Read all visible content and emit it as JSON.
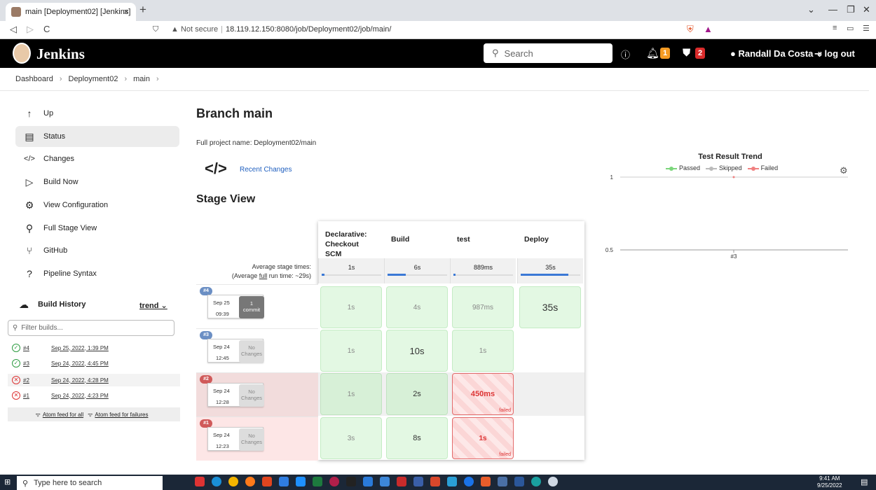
{
  "browser": {
    "tab_title": "main [Deployment02] [Jenkins]",
    "tab_close": "×",
    "new_tab": "+",
    "url_security": "Not secure",
    "url": "18.119.12.150:8080/job/Deployment02/job/main/"
  },
  "header": {
    "logo": "Jenkins",
    "search_placeholder": "Search",
    "notifications_count": "1",
    "security_count": "2",
    "user_name": "Randall Da Costa",
    "logout_label": "log out"
  },
  "breadcrumbs": [
    "Dashboard",
    "Deployment02",
    "main"
  ],
  "sidebar": {
    "items": [
      {
        "label": "Up",
        "icon": "arrow-up-icon"
      },
      {
        "label": "Status",
        "icon": "document-icon"
      },
      {
        "label": "Changes",
        "icon": "code-icon"
      },
      {
        "label": "Build Now",
        "icon": "play-icon"
      },
      {
        "label": "View Configuration",
        "icon": "gear-icon"
      },
      {
        "label": "Full Stage View",
        "icon": "search-icon"
      },
      {
        "label": "GitHub",
        "icon": "branch-icon"
      },
      {
        "label": "Pipeline Syntax",
        "icon": "help-icon"
      }
    ],
    "build_history_title": "Build History",
    "trend_label": "trend",
    "filter_placeholder": "Filter builds...",
    "builds": [
      {
        "num": "#4",
        "date": "Sep 25, 2022, 1:39 PM",
        "status": "success"
      },
      {
        "num": "#3",
        "date": "Sep 24, 2022, 4:45 PM",
        "status": "success"
      },
      {
        "num": "#2",
        "date": "Sep 24, 2022, 4:28 PM",
        "status": "failed"
      },
      {
        "num": "#1",
        "date": "Sep 24, 2022, 4:23 PM",
        "status": "failed"
      }
    ],
    "feed_all": "Atom feed for all",
    "feed_failures": "Atom feed for failures"
  },
  "main": {
    "title": "Branch main",
    "full_name": "Full project name: Deployment02/main",
    "recent_changes": "Recent Changes",
    "stage_view_title": "Stage View",
    "avg_label_1": "Average stage times:",
    "avg_label_2a": "(Average ",
    "avg_label_2b": "full",
    "avg_label_2c": " run time: ~29s)",
    "stages": [
      {
        "name": "Declarative: Checkout SCM",
        "avg": "1s",
        "avg_fill": 0.05
      },
      {
        "name": "Build",
        "avg": "6s",
        "avg_fill": 0.3
      },
      {
        "name": "test",
        "avg": "889ms",
        "avg_fill": 0.04
      },
      {
        "name": "Deploy",
        "avg": "35s",
        "avg_fill": 0.8
      }
    ],
    "runs": [
      {
        "num": "#4",
        "month_day": "Sep 25",
        "time": "09:39",
        "changes": "1\ncommit",
        "cells": [
          "1s",
          "4s",
          "987ms",
          "35s"
        ]
      },
      {
        "num": "#3",
        "month_day": "Sep 24",
        "time": "12:45",
        "changes": "No\nChanges",
        "cells": [
          "1s",
          "10s",
          "1s",
          ""
        ]
      },
      {
        "num": "#2",
        "month_day": "Sep 24",
        "time": "12:28",
        "changes": "No\nChanges",
        "cells": [
          "1s",
          "2s",
          "450ms",
          ""
        ]
      },
      {
        "num": "#1",
        "month_day": "Sep 24",
        "time": "12:23",
        "changes": "No\nChanges",
        "cells": [
          "3s",
          "8s",
          "1s",
          ""
        ]
      }
    ],
    "failed_label": "failed"
  },
  "chart_data": {
    "type": "area",
    "title": "Test Result Trend",
    "legend": [
      "Passed",
      "Skipped",
      "Failed"
    ],
    "colors": {
      "Passed": "#7bd67b",
      "Skipped": "#bbbbbb",
      "Failed": "#f08080"
    },
    "y_ticks": [
      "1",
      "0.5"
    ],
    "x": [
      "#3"
    ],
    "series": [
      {
        "name": "Passed",
        "values": [
          0
        ]
      },
      {
        "name": "Skipped",
        "values": [
          0
        ]
      },
      {
        "name": "Failed",
        "values": [
          1
        ]
      }
    ]
  },
  "taskbar": {
    "search_placeholder": "Type here to search",
    "time": "9:41 AM",
    "date": "9/25/2022"
  }
}
